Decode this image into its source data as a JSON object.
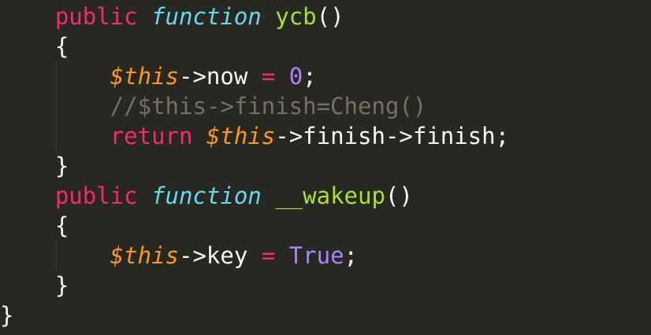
{
  "editor": {
    "theme": {
      "background": "#272822",
      "keyword": "#f92672",
      "storage": "#66d9ef",
      "function_name": "#a6e22e",
      "variable": "#fd971f",
      "constant": "#ae81ff",
      "comment": "#75715e",
      "text": "#f8f8f2"
    },
    "lines": [
      {
        "tokens": [
          {
            "t": "    ",
            "c": "plain"
          },
          {
            "t": "public",
            "c": "kw"
          },
          {
            "t": " ",
            "c": "plain"
          },
          {
            "t": "function",
            "c": "fn-kw"
          },
          {
            "t": " ",
            "c": "plain"
          },
          {
            "t": "ycb",
            "c": "name"
          },
          {
            "t": "()",
            "c": "plain"
          }
        ]
      },
      {
        "tokens": [
          {
            "t": "    ",
            "c": "plain"
          },
          {
            "t": "{",
            "c": "plain"
          }
        ]
      },
      {
        "tokens": [
          {
            "t": "        ",
            "c": "plain"
          },
          {
            "t": "$this",
            "c": "var"
          },
          {
            "t": "->now ",
            "c": "plain"
          },
          {
            "t": "=",
            "c": "op"
          },
          {
            "t": " ",
            "c": "plain"
          },
          {
            "t": "0",
            "c": "num"
          },
          {
            "t": ";",
            "c": "plain"
          }
        ]
      },
      {
        "tokens": [
          {
            "t": "        ",
            "c": "plain"
          },
          {
            "t": "//$this->finish=Cheng()",
            "c": "comment"
          }
        ]
      },
      {
        "tokens": [
          {
            "t": "        ",
            "c": "plain"
          },
          {
            "t": "return",
            "c": "kw"
          },
          {
            "t": " ",
            "c": "plain"
          },
          {
            "t": "$this",
            "c": "var"
          },
          {
            "t": "->finish->finish;",
            "c": "plain"
          }
        ]
      },
      {
        "tokens": [
          {
            "t": "    ",
            "c": "plain"
          },
          {
            "t": "}",
            "c": "plain"
          }
        ]
      },
      {
        "tokens": [
          {
            "t": "    ",
            "c": "plain"
          },
          {
            "t": "public",
            "c": "kw"
          },
          {
            "t": " ",
            "c": "plain"
          },
          {
            "t": "function",
            "c": "fn-kw"
          },
          {
            "t": " ",
            "c": "plain"
          },
          {
            "t": "__wakeup",
            "c": "name"
          },
          {
            "t": "()",
            "c": "plain"
          }
        ]
      },
      {
        "tokens": [
          {
            "t": "    ",
            "c": "plain"
          },
          {
            "t": "{",
            "c": "plain"
          }
        ]
      },
      {
        "tokens": [
          {
            "t": "        ",
            "c": "plain"
          },
          {
            "t": "$this",
            "c": "var"
          },
          {
            "t": "->key ",
            "c": "plain"
          },
          {
            "t": "=",
            "c": "op"
          },
          {
            "t": " ",
            "c": "plain"
          },
          {
            "t": "True",
            "c": "const"
          },
          {
            "t": ";",
            "c": "plain"
          }
        ]
      },
      {
        "tokens": [
          {
            "t": "    ",
            "c": "plain"
          },
          {
            "t": "}",
            "c": "plain"
          }
        ]
      },
      {
        "tokens": [
          {
            "t": "}",
            "c": "plain"
          }
        ]
      }
    ]
  }
}
